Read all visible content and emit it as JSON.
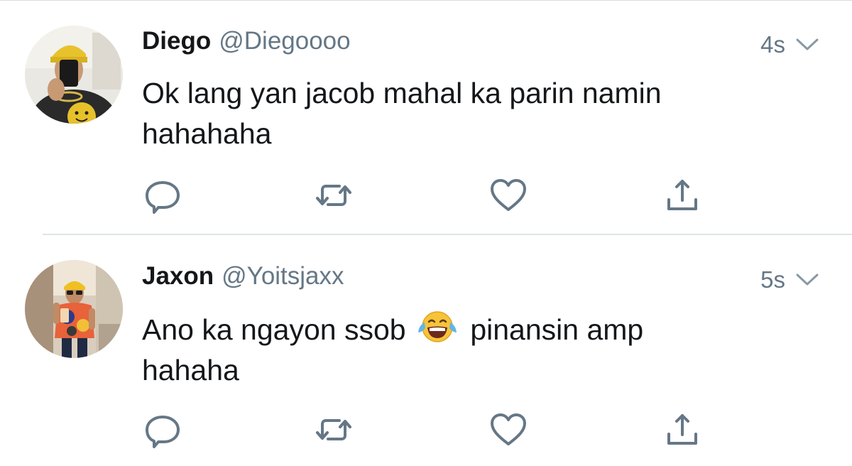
{
  "tweets": [
    {
      "display_name": "Diego",
      "handle": "@Diegoooo",
      "time": "4s",
      "text_lines": [
        "Ok lang yan jacob mahal ka parin namin",
        "hahahaha"
      ],
      "avatar": "profile-photo-person-yellow-cap-smiley-shirt"
    },
    {
      "display_name": "Jaxon",
      "handle": "@Yoitsjaxx",
      "time": "5s",
      "text_before_emoji": "Ano ka ngayon ssob ",
      "emoji": "face-with-tears-of-joy",
      "text_after_emoji": " pinansin amp",
      "text_line2": "hahaha",
      "avatar": "profile-photo-person-tie-dye-shirt"
    }
  ],
  "actions": [
    "reply-icon",
    "retweet-icon",
    "like-icon",
    "share-icon"
  ],
  "colors": {
    "text_primary": "#14171a",
    "text_secondary": "#657786",
    "icon": "#657786",
    "divider": "#dfe3e7"
  }
}
